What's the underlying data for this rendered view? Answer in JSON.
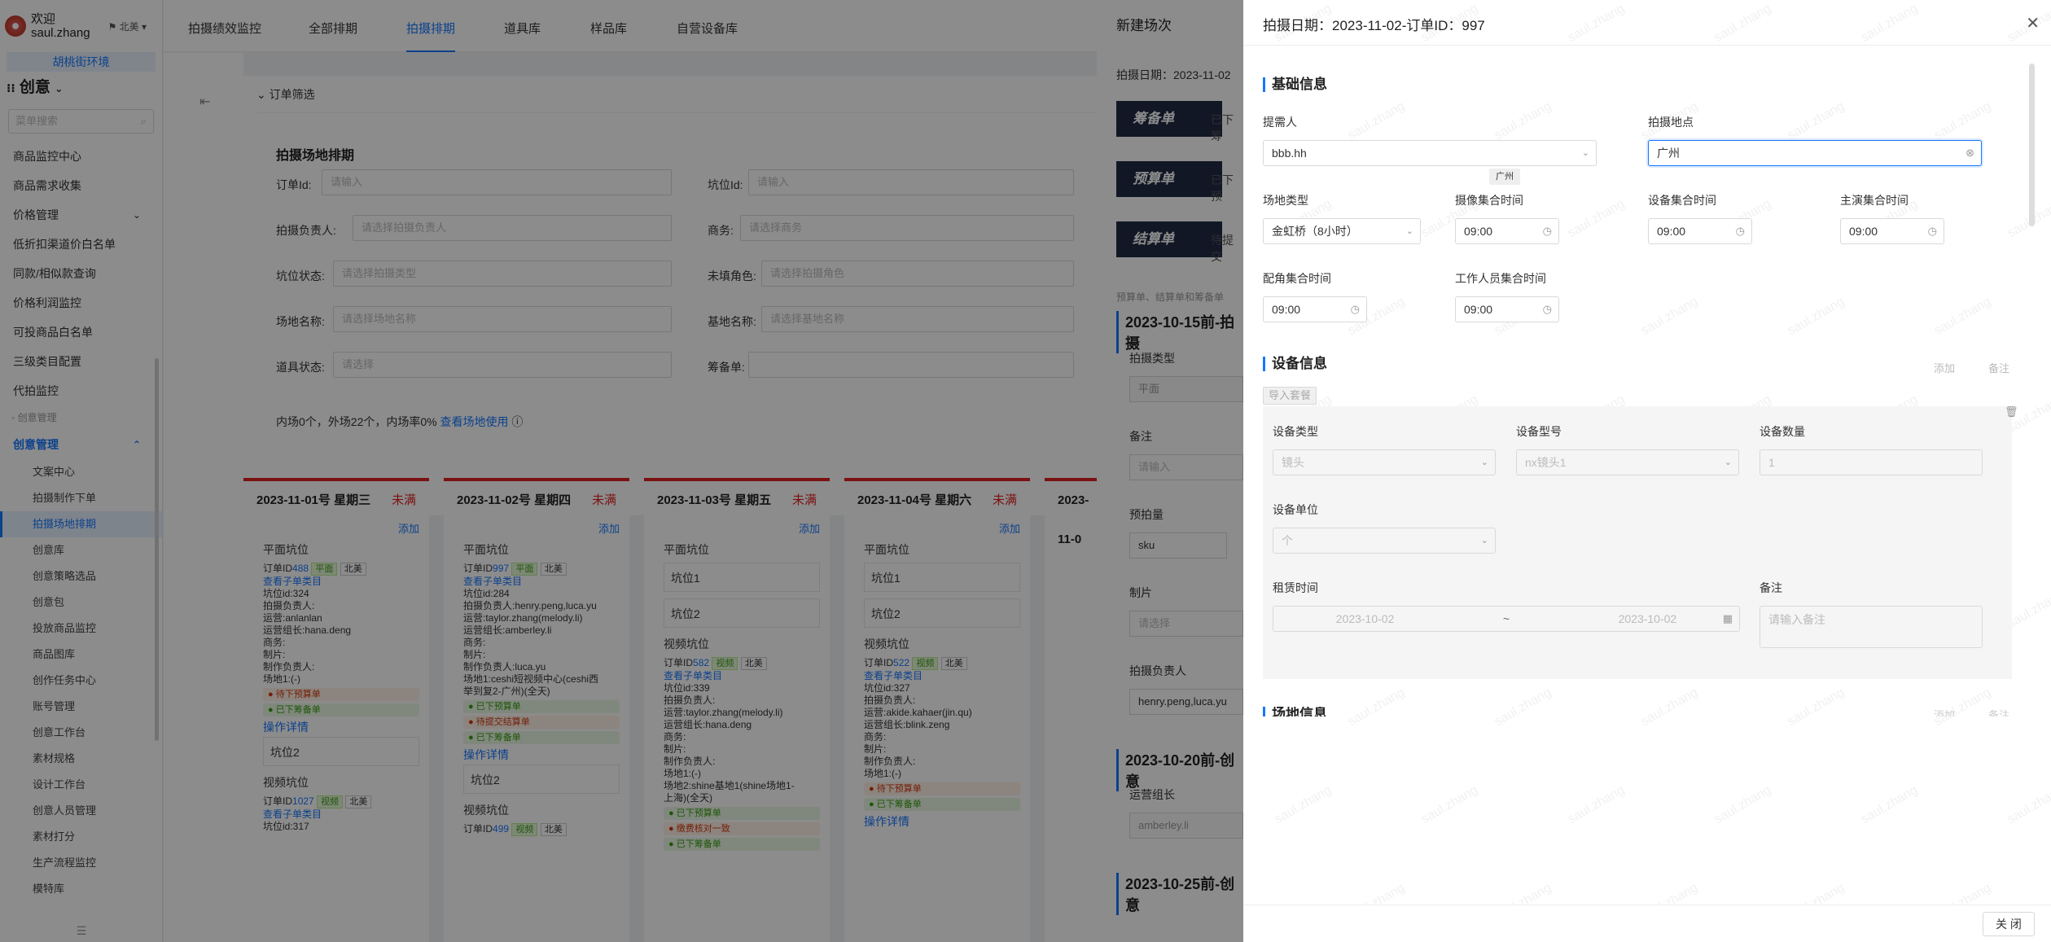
{
  "sidebar": {
    "welcome": "欢迎",
    "username": "saul.zhang",
    "region": "北美",
    "env_label": "胡桃街环境",
    "module": "创意",
    "search_placeholder": "菜单搜索",
    "items": [
      "商品监控中心",
      "商品需求收集",
      "价格管理",
      "低折扣渠道价白名单",
      "同款/相似款查询",
      "价格利润监控",
      "可投商品白名单",
      "三级类目配置",
      "代拍监控"
    ],
    "group1": "创意管理",
    "open_group": "创意管理",
    "subitems": [
      "文案中心",
      "拍摄制作下单",
      "拍摄场地排期",
      "创意库",
      "创意策略选品",
      "创意包",
      "投放商品监控",
      "商品图库",
      "创作任务中心",
      "账号管理",
      "创意工作台",
      "素材规格",
      "设计工作台",
      "创意人员管理",
      "素材打分",
      "生产流程监控",
      "模特库"
    ]
  },
  "topnav": {
    "tabs": [
      "拍摄绩效监控",
      "全部排期",
      "拍摄排期",
      "道具库",
      "样品库",
      "自营设备库"
    ]
  },
  "main": {
    "filter": {
      "header": "订单筛选",
      "title": "拍摄场地排期",
      "fields": [
        {
          "label": "订单Id:",
          "placeholder": "请输入"
        },
        {
          "label": "坑位Id:",
          "placeholder": "请输入"
        },
        {
          "label": "拍摄负责人:",
          "placeholder": "请选择拍摄负责人"
        },
        {
          "label": "商务:",
          "placeholder": "请选择商务"
        },
        {
          "label": "坑位状态:",
          "placeholder": "请选择拍摄类型"
        },
        {
          "label": "未填角色:",
          "placeholder": "请选择拍摄角色"
        },
        {
          "label": "场地名称:",
          "placeholder": "请选择场地名称"
        },
        {
          "label": "基地名称:",
          "placeholder": "请选择基地名称"
        },
        {
          "label": "道具状态:",
          "placeholder": "请选择"
        },
        {
          "label": "筹备单:",
          "placeholder": ""
        }
      ],
      "stats": "内场0个，外场22个，内场率0%",
      "stats_link": "查看场地使用"
    },
    "add": "添加",
    "flat_slot": "平面坑位",
    "video_slot": "视频坑位",
    "tag_flat": "平面",
    "tag_video": "视频",
    "tag_north": "北美",
    "view_sub": "查看子单类目",
    "op_detail": "操作详情",
    "days": [
      {
        "date": "2023-11-01号 星期三",
        "status": "未满",
        "slot": {
          "order_prefix": "订单ID",
          "order_id": "488",
          "lines": [
            "坑位id:324",
            "拍摄负责人:",
            "运营:anlanlan",
            "运营组长:hana.deng",
            "商务:",
            "制片:",
            "制作负责人:",
            "场地1:(-)"
          ],
          "pills": [
            "● 待下预算单",
            "● 已下筹备单"
          ]
        },
        "slot2": "坑位2",
        "slot_v": {
          "order_prefix": "订单ID",
          "order_id": "1027",
          "lines": [
            "坑位id:317"
          ]
        }
      },
      {
        "date": "2023-11-02号 星期四",
        "status": "未满",
        "slot": {
          "order_prefix": "订单ID",
          "order_id": "997",
          "lines": [
            "坑位id:284",
            "拍摄负责人:henry.peng,luca.yu",
            "运营:taylor.zhang(melody.li)",
            "运营组长:amberley.li",
            "商务:",
            "制片:",
            "制作负责人:luca.yu",
            "场地1:ceshi短视频中心(ceshi西",
            "举到复2-广州)(全天)"
          ],
          "pills": [
            "● 已下预算单",
            "● 待提交结算单",
            "● 已下筹备单"
          ]
        },
        "slot2": "坑位2",
        "slot_v": {
          "order_prefix": "订单ID",
          "order_id": "499"
        }
      },
      {
        "date": "2023-11-03号 星期五",
        "status": "未满",
        "boxes": [
          "坑位1",
          "坑位2"
        ],
        "slot_v": {
          "order_prefix": "订单ID",
          "order_id": "582",
          "lines": [
            "坑位id:339",
            "拍摄负责人:",
            "运营:taylor.zhang(melody.li)",
            "运营组长:hana.deng",
            "商务:",
            "制片:",
            "制作负责人:",
            "场地1:(-)",
            "场地2:shine基地1(shine场地1-",
            "上海)(全天)"
          ],
          "pills": [
            "● 已下预算单",
            "● 缴费核对一致",
            "● 已下筹备单"
          ]
        }
      },
      {
        "date": "2023-11-04号 星期六",
        "status": "未满",
        "boxes": [
          "坑位1",
          "坑位2"
        ],
        "slot_v": {
          "order_prefix": "订单ID",
          "order_id": "522",
          "lines": [
            "坑位id:327",
            "拍摄负责人:",
            "运营:akide.kahaer(jin.qu)",
            "运营组长:blink.zeng",
            "商务:",
            "制片:",
            "制作负责人:",
            "场地1:(-)"
          ],
          "pills": [
            "● 待下预算单",
            "● 已下筹备单"
          ]
        }
      },
      {
        "date": "2023-11-0"
      }
    ]
  },
  "drawer1": {
    "title": "新建场次",
    "date": "拍摄日期：2023-11-02",
    "btn0": "筹备单",
    "btn0_state": "已下筹",
    "btn1": "预算单",
    "btn1_state": "已下预",
    "btn2": "结算单",
    "btn2_state": "待提交",
    "note": "预算单、结算单和筹备单",
    "sections": [
      "2023-10-15前-拍摄",
      "2023-10-20前-创意",
      "2023-10-25前-创意"
    ],
    "labels": [
      "拍摄类型",
      "备注",
      "预拍量",
      "制片",
      "拍摄负责人",
      "运营组长"
    ],
    "values": [
      "平面",
      "请输入",
      "sku",
      "请选择",
      "henry.peng,luca.yu",
      "amberley.li"
    ]
  },
  "drawer2": {
    "title": "拍摄日期：2023-11-02-订单ID：997",
    "basic": {
      "title": "基础信息",
      "requester_label": "提需人",
      "requester": "bbb.hh",
      "location_label": "拍摄地点",
      "location": "广州",
      "location_tip": "广州",
      "venue_type_label": "场地类型",
      "venue_type": "金虹桥（8小时）",
      "times": [
        {
          "label": "摄像集合时间",
          "value": "09:00"
        },
        {
          "label": "设备集合时间",
          "value": "09:00"
        },
        {
          "label": "主演集合时间",
          "value": "09:00"
        },
        {
          "label": "配角集合时间",
          "value": "09:00"
        },
        {
          "label": "工作人员集合时间",
          "value": "09:00"
        }
      ]
    },
    "equipment": {
      "title": "设备信息",
      "add": "添加",
      "remark": "备注",
      "import": "导入套餐",
      "row": {
        "type_label": "设备类型",
        "type": "镜头",
        "model_label": "设备型号",
        "model": "nx镜头1",
        "qty_label": "设备数量",
        "qty": "1",
        "unit_label": "设备单位",
        "unit": "个",
        "rental_label": "租赁时间",
        "start": "2023-10-02",
        "end": "2023-10-02",
        "remark_label": "备注",
        "remark_placeholder": "请输入备注"
      }
    },
    "venue": {
      "title": "场地信息",
      "add": "添加",
      "remark": "备注"
    },
    "close": "关 闭",
    "watermark": "saul.zhang"
  }
}
